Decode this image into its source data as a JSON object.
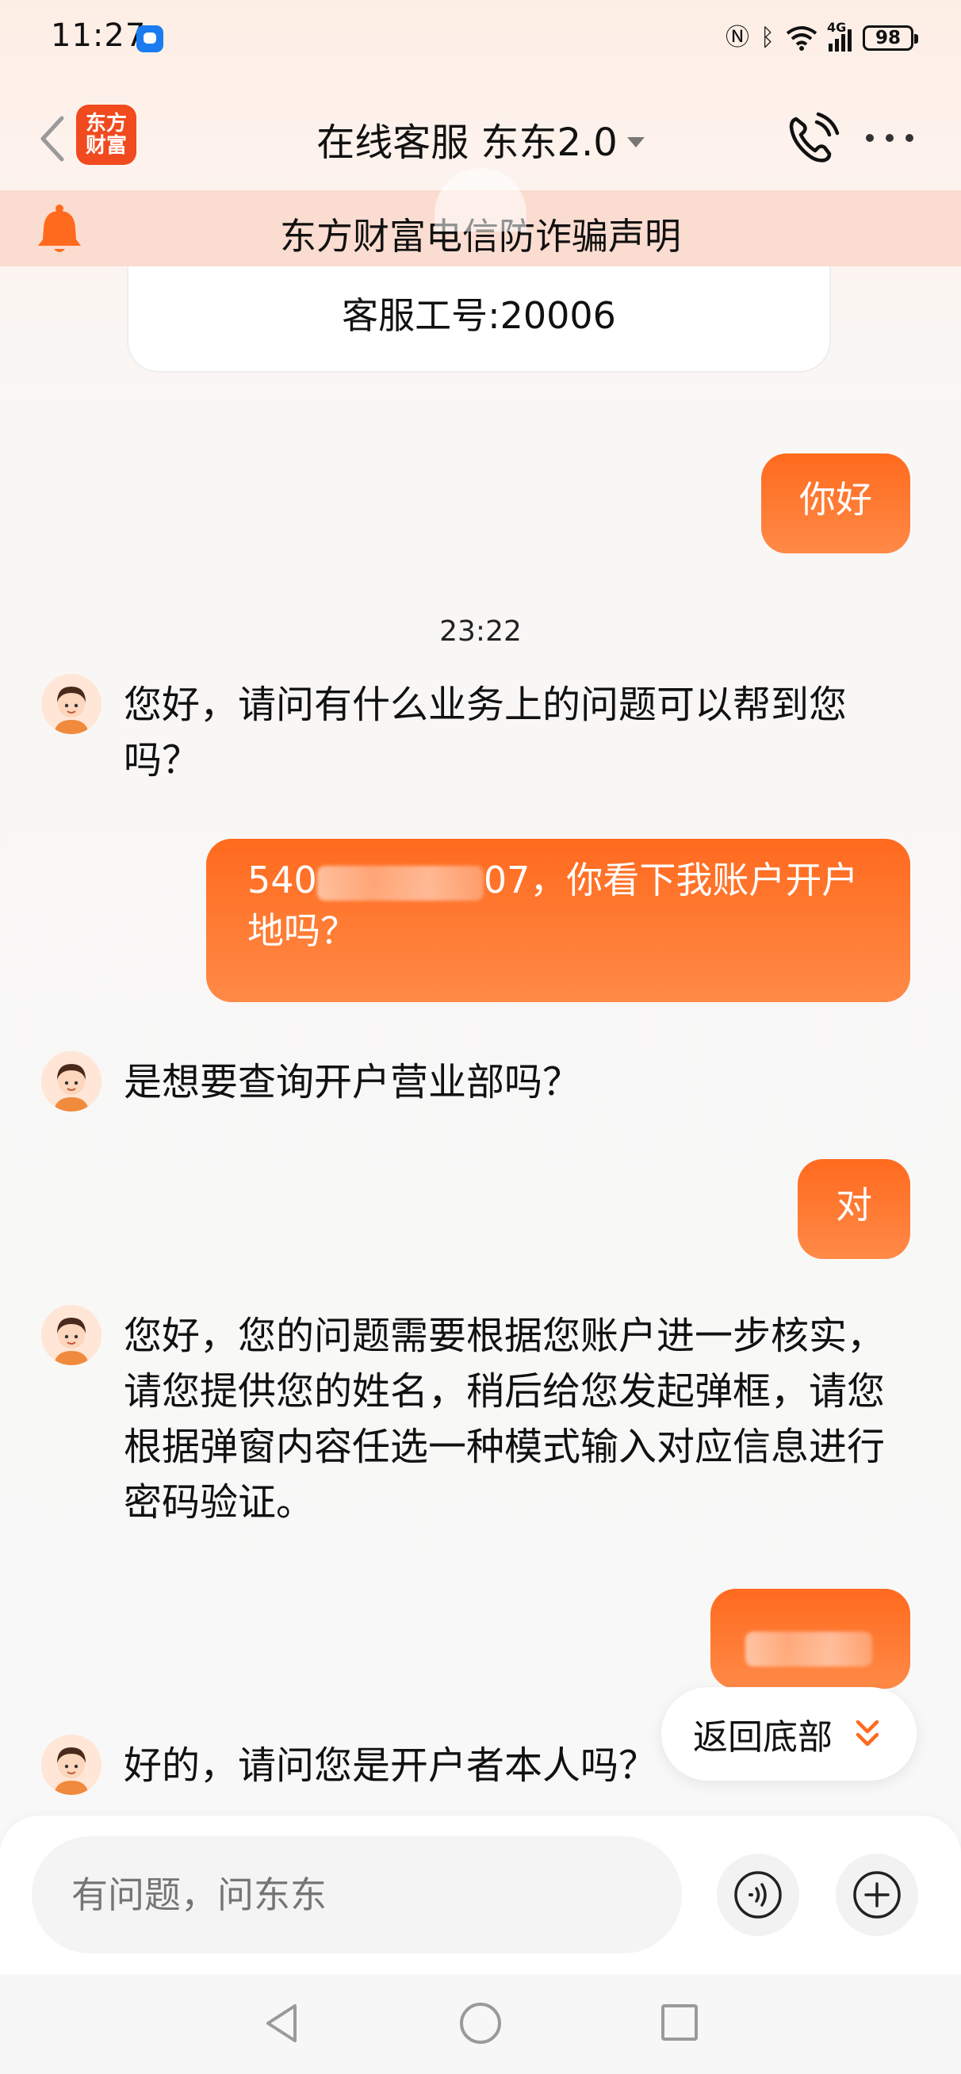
{
  "status_bar": {
    "time": "11:27",
    "network": "4G",
    "battery": "98"
  },
  "header": {
    "logo_line1": "东方",
    "logo_line2": "财富",
    "title": "在线客服 东东2.0"
  },
  "notice": {
    "text": "东方财富电信防诈骗声明"
  },
  "agent_card": {
    "text": "客服工号:20006"
  },
  "messages": {
    "m1_user": "你好",
    "timestamp": "23:22",
    "m2_agent": "您好，请问有什么业务上的问题可以帮到您吗？",
    "m3_user_prefix": "540",
    "m3_user_suffix": "07，你看下我账户开户地吗？",
    "m4_agent": "是想要查询开户营业部吗？",
    "m5_user": "对",
    "m6_agent": "您好，您的问题需要根据您账户进一步核实，请您提供您的姓名，稍后给您发起弹框，请您根据弹窗内容任选一种模式输入对应信息进行密码验证。",
    "m8_agent": "好的，请问您是开户者本人吗？"
  },
  "scroll_button": {
    "label": "返回底部"
  },
  "input": {
    "placeholder": "有问题，问东东"
  },
  "colors": {
    "accent": "#ff6a1e",
    "logo": "#f04a1e",
    "notice_bg": "#fbdcd0"
  }
}
